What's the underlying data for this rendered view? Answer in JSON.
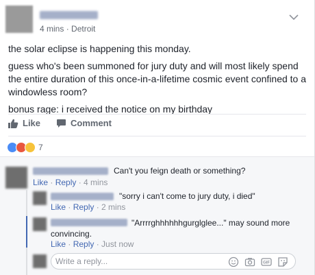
{
  "post": {
    "time": "4 mins",
    "location": "Detroit",
    "paragraphs": [
      "the solar eclipse is happening this monday.",
      "guess who's been summoned for jury duty and will most likely spend the entire duration of this once-in-a-lifetime cosmic event confined to a windowless room?",
      "bonus rage: i received the notice on my birthday"
    ]
  },
  "actions": {
    "like": "Like",
    "comment": "Comment"
  },
  "reactions": {
    "count": "7",
    "types": [
      "like-icon",
      "angry-icon",
      "sad-icon"
    ]
  },
  "comments": [
    {
      "text": "Can't you feign death or something?",
      "like": "Like",
      "reply": "Reply",
      "time": "4 mins"
    },
    {
      "text": "\"sorry i can't come to jury duty, i died\"",
      "like": "Like",
      "reply": "Reply",
      "time": "2 mins"
    },
    {
      "text": "\"Arrrrghhhhhhgurglglee...\" may sound more convincing.",
      "like": "Like",
      "reply": "Reply",
      "time": "Just now"
    }
  ],
  "reply_box": {
    "placeholder": "Write a reply..."
  },
  "colors": {
    "link": "#4267b2",
    "meta": "#90949c",
    "accent_bar": "#4267b2"
  }
}
